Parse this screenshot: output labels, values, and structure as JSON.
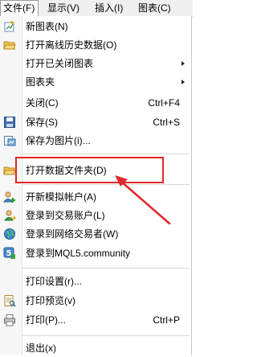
{
  "menubar": {
    "items": [
      {
        "label": "文件(F)"
      },
      {
        "label": "显示(V)"
      },
      {
        "label": "插入(I)"
      },
      {
        "label": "图表(C)"
      }
    ]
  },
  "menu": {
    "items": [
      {
        "label": "新图表(N)",
        "icon": "new-chart-icon",
        "submenu": false,
        "shortcut": ""
      },
      {
        "label": "打开离线历史数据(O)",
        "icon": "open-folder-icon",
        "submenu": false,
        "shortcut": ""
      },
      {
        "label": "打开已关闭图表",
        "icon": "",
        "submenu": true,
        "shortcut": ""
      },
      {
        "label": "图表夹",
        "icon": "",
        "submenu": true,
        "shortcut": ""
      },
      {
        "label": "关闭(C)",
        "icon": "",
        "submenu": false,
        "shortcut": "Ctrl+F4"
      },
      {
        "label": "保存(S)",
        "icon": "floppy-save-icon",
        "submenu": false,
        "shortcut": "Ctrl+S"
      },
      {
        "label": "保存为图片(i)...",
        "icon": "save-picture-icon",
        "submenu": false,
        "shortcut": ""
      },
      {
        "label": "打开数据文件夹(D)",
        "icon": "open-folder-icon",
        "submenu": false,
        "shortcut": "",
        "highlighted": true
      },
      {
        "label": "开新模拟帐户(A)",
        "icon": "add-user-icon",
        "submenu": false,
        "shortcut": ""
      },
      {
        "label": "登录到交易账户(L)",
        "icon": "login-user-icon",
        "submenu": false,
        "shortcut": ""
      },
      {
        "label": "登录到网络交易者(W)",
        "icon": "web-trader-icon",
        "submenu": false,
        "shortcut": ""
      },
      {
        "label": "登录到MQL5.community",
        "icon": "mql5-community-icon",
        "submenu": false,
        "shortcut": ""
      },
      {
        "label": "打印设置(r)...",
        "icon": "",
        "submenu": false,
        "shortcut": ""
      },
      {
        "label": "打印预览(v)",
        "icon": "print-preview-icon",
        "submenu": false,
        "shortcut": ""
      },
      {
        "label": "打印(P)...",
        "icon": "printer-icon",
        "submenu": false,
        "shortcut": "Ctrl+P"
      },
      {
        "label": "退出(x)",
        "icon": "",
        "submenu": false,
        "shortcut": ""
      }
    ]
  },
  "colors": {
    "annotation_red": "#e2262a",
    "menubar_bg": "#f0f0f0"
  }
}
